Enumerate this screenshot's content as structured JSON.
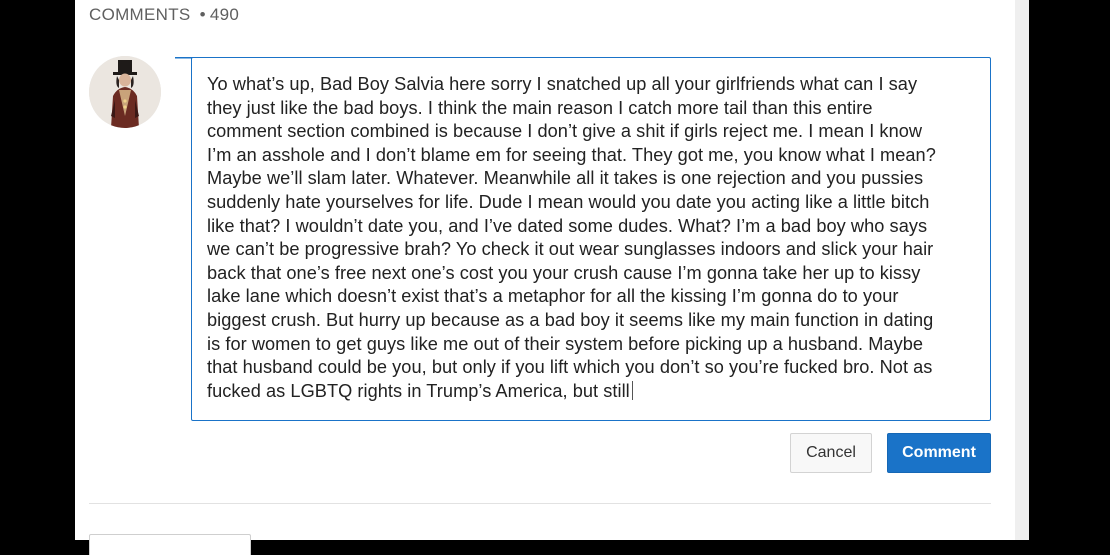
{
  "comments_header": {
    "label": "COMMENTS",
    "separator": "•",
    "count": "490"
  },
  "composer": {
    "text": "Yo what’s up, Bad Boy Salvia here sorry I snatched up all your girlfriends what can I say\nthey just like the bad boys. I think the main reason I catch more tail than this entire\ncomment section combined is because I don’t give a shit if girls reject me. I mean I know\nI’m an asshole and I don’t blame em for seeing that. They got me, you know what I mean?\nMaybe we’ll slam later. Whatever. Meanwhile all it takes is one rejection and you pussies\nsuddenly hate yourselves for life. Dude I mean would you date you acting like a little bitch\nlike that? I wouldn’t date you, and I’ve dated some dudes. What? I’m a bad boy who says\nwe can’t be progressive brah? Yo check it out wear sunglasses indoors and slick your hair\nback that one’s free next one’s cost you your crush cause I’m gonna take her up to kissy\nlake lane which doesn’t exist that’s a metaphor for all the kissing I’m gonna do to your\nbiggest crush. But hurry up because as a bad boy it seems like my main function in dating\nis for women to get guys like me out of their system before picking up a husband. Maybe\nthat husband could be you, but only if you lift which you don’t so you’re fucked bro. Not as\nfucked as LGBTQ rights in Trump’s America, but still"
  },
  "buttons": {
    "cancel": "Cancel",
    "comment": "Comment"
  },
  "colors": {
    "accent": "#1a73c8",
    "header_text": "#5f5f5f",
    "body_text": "#222222"
  },
  "icons": {
    "avatar": "user-avatar-top-hat-figure"
  }
}
